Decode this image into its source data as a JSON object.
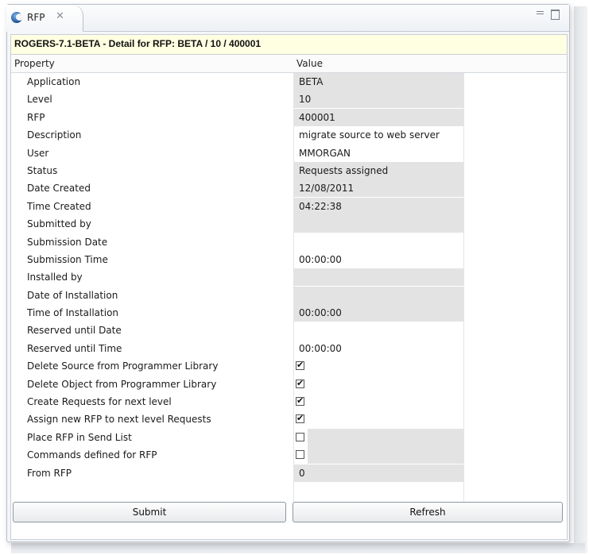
{
  "tab": {
    "label": "RFP",
    "close_glyph": "✕"
  },
  "header": {
    "title": "ROGERS-7.1-BETA -  Detail for RFP: BETA / 10 / 400001"
  },
  "table": {
    "columns": [
      "Property",
      "Value"
    ],
    "rows": [
      {
        "property": "Application",
        "value": "BETA",
        "gray": true
      },
      {
        "property": "Level",
        "value": "10",
        "gray": true
      },
      {
        "property": "RFP",
        "value": "400001",
        "gray": true
      },
      {
        "property": "Description",
        "value": "migrate source to web server",
        "gray": false
      },
      {
        "property": "User",
        "value": "MMORGAN",
        "gray": false
      },
      {
        "property": "Status",
        "value": "Requests assigned",
        "gray": true
      },
      {
        "property": "Date Created",
        "value": "12/08/2011",
        "gray": true
      },
      {
        "property": "Time Created",
        "value": "04:22:38",
        "gray": true
      },
      {
        "property": "Submitted by",
        "value": "",
        "gray": true
      },
      {
        "property": "Submission Date",
        "value": "",
        "gray": false
      },
      {
        "property": "Submission Time",
        "value": "00:00:00",
        "gray": false
      },
      {
        "property": "Installed by",
        "value": "",
        "gray": true
      },
      {
        "property": "Date of Installation",
        "value": "",
        "gray": true
      },
      {
        "property": "Time of Installation",
        "value": "00:00:00",
        "gray": true
      },
      {
        "property": "Reserved until Date",
        "value": "",
        "gray": false
      },
      {
        "property": "Reserved until Time",
        "value": "00:00:00",
        "gray": false
      },
      {
        "property": "Delete Source from Programmer Library",
        "checkbox": true,
        "checked": true
      },
      {
        "property": "Delete Object from Programmer Library",
        "checkbox": true,
        "checked": true
      },
      {
        "property": "Create Requests for next level",
        "checkbox": true,
        "checked": true
      },
      {
        "property": "Assign new RFP to next level Requests",
        "checkbox": true,
        "checked": true
      },
      {
        "property": "Place RFP in Send List",
        "checkbox": true,
        "checked": false,
        "gray": true
      },
      {
        "property": "Commands defined for RFP",
        "checkbox": true,
        "checked": false,
        "gray": true
      },
      {
        "property": "From RFP",
        "value": "0",
        "gray": true
      }
    ]
  },
  "buttons": {
    "submit": "Submit",
    "refresh": "Refresh"
  }
}
